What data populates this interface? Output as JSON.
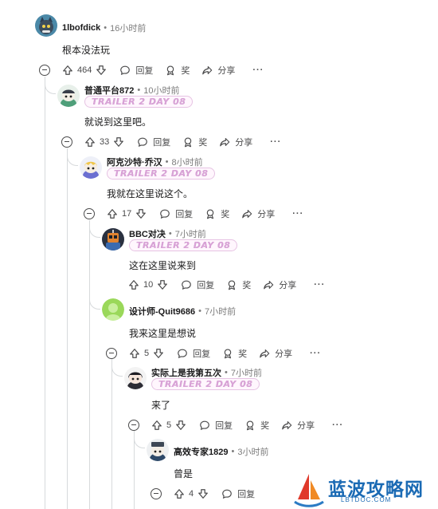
{
  "comments": [
    {
      "username": "1lbofdick",
      "time": "16小时前",
      "flair": "",
      "text": "根本没法玩",
      "votes": "464",
      "reply_label": "回复",
      "award_label": "奖",
      "share_label": "分享",
      "avatar": "avatar-cat-icon"
    },
    {
      "username": "普通平台872",
      "time": "10小时前",
      "flair": "TRAILER 2 DAY 08",
      "text": "就说到这里吧。",
      "votes": "33",
      "reply_label": "回复",
      "award_label": "奖",
      "share_label": "分享",
      "avatar": "avatar-snoo-icon"
    },
    {
      "username": "阿克沙特·乔汉",
      "time": "8小时前",
      "flair": "TRAILER 2 DAY 08",
      "text": "我就在这里说这个。",
      "votes": "17",
      "reply_label": "回复",
      "award_label": "奖",
      "share_label": "分享",
      "avatar": "avatar-snoo-icon"
    },
    {
      "username": "BBC对决",
      "time": "7小时前",
      "flair": "TRAILER 2 DAY 08",
      "text": "这在这里说来到",
      "votes": "10",
      "reply_label": "回复",
      "award_label": "奖",
      "share_label": "分享",
      "avatar": "avatar-robot-icon"
    },
    {
      "username": "设计师-Quit9686",
      "time": "7小时前",
      "flair": "",
      "text": "我来这里是想说",
      "votes": "5",
      "reply_label": "回复",
      "award_label": "奖",
      "share_label": "分享",
      "avatar": "avatar-default-icon"
    },
    {
      "username": "实际上是我第五次",
      "time": "7小时前",
      "flair": "TRAILER 2 DAY 08",
      "text": "来了",
      "votes": "5",
      "reply_label": "回复",
      "award_label": "奖",
      "share_label": "分享",
      "avatar": "avatar-snoo-icon"
    },
    {
      "username": "高效专家1829",
      "time": "3小时前",
      "flair": "",
      "text": "曾是",
      "votes": "4",
      "reply_label": "回复",
      "award_label": "",
      "share_label": "",
      "avatar": "avatar-snoo-icon"
    }
  ],
  "watermark": {
    "title": "蓝波攻略网",
    "subtitle": "LBTDOC.COM"
  },
  "colors": {
    "thread_line": "#d7dadc",
    "meta_gray": "#7c7c7c",
    "flair_text": "#d9a3d7",
    "watermark_blue": "#1a6ab4"
  }
}
